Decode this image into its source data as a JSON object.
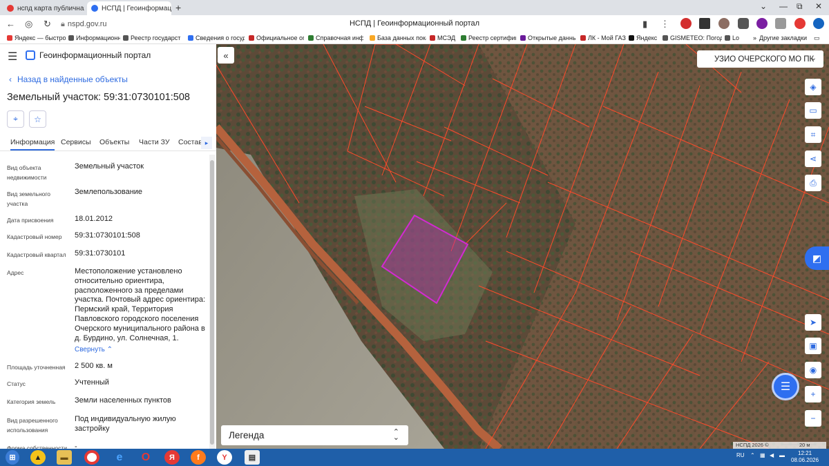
{
  "browser": {
    "tabs": [
      {
        "label": "нспд карта публичная кад",
        "color": "#e53935"
      },
      {
        "label": "НСПД | Геоинформацион",
        "color": "#2f6ff0"
      }
    ],
    "url": "nspd.gov.ru",
    "page_title": "НСПД | Геоинформационный портал",
    "bookmarks": [
      {
        "label": "Яндекс — быстро",
        "color": "#e53935"
      },
      {
        "label": "Информационно",
        "color": "#555"
      },
      {
        "label": "Реестр государст",
        "color": "#555"
      },
      {
        "label": "Сведения о госуд",
        "color": "#2f6ff0"
      },
      {
        "label": "Официальное оп",
        "color": "#c62828"
      },
      {
        "label": "Справочная инф",
        "color": "#2e7d32"
      },
      {
        "label": "База данных пока",
        "color": "#f9a825"
      },
      {
        "label": "МСЭД",
        "color": "#c62828"
      },
      {
        "label": "Реестр сертифик",
        "color": "#2e7d32"
      },
      {
        "label": "Открытые данны",
        "color": "#6a1b9a"
      },
      {
        "label": "ЛК - Мой ГАЗ",
        "color": "#c62828"
      },
      {
        "label": "Яндекс",
        "color": "#111"
      },
      {
        "label": "GISMETEO: Погод",
        "color": "#555"
      },
      {
        "label": "Lo",
        "color": "#555"
      }
    ],
    "other_bookmarks": "Другие закладки"
  },
  "panel": {
    "portal_name": "Геоинформационный портал",
    "back_label": "Назад в найденные объекты",
    "title": "Земельный участок: 59:31:0730101:508",
    "tabs": [
      "Информация",
      "Сервисы",
      "Объекты",
      "Части ЗУ",
      "Состав"
    ],
    "rows": [
      {
        "key": "Вид объекта недвижимости",
        "value": "Земельный участок"
      },
      {
        "key": "Вид земельного участка",
        "value": "Землепользование"
      },
      {
        "key": "Дата присвоения",
        "value": "18.01.2012"
      },
      {
        "key": "Кадастровый номер",
        "value": "59:31:0730101:508"
      },
      {
        "key": "Кадастровый квартал",
        "value": "59:31:0730101"
      },
      {
        "key": "Адрес",
        "value": "Местоположение установлено относительно ориентира, расположенного за пределами участка. Почтовый адрес ориентира: Пермский край, Территория Павловского городского поселения Очерского муниципального района в д. Бурдино, ул. Солнечная, 1."
      },
      {
        "key": "Площадь уточненная",
        "value": "2 500 кв. м"
      },
      {
        "key": "Статус",
        "value": "Учтенный"
      },
      {
        "key": "Категория земель",
        "value": "Земли населенных пунктов"
      },
      {
        "key": "Вид разрешенного использования",
        "value": "Под индивидуальную жилую застройку"
      },
      {
        "key": "Форма собственности",
        "value": "-"
      }
    ],
    "collapse_label": "Свернуть"
  },
  "map": {
    "municipality": "УЗИО ОЧЕРСКОГО МО ПК",
    "legend_label": "Легенда",
    "copyright": "НСПД 2026 ©",
    "scale_label": "20 м",
    "parcel_color": "#c020c0",
    "boundary_color": "#ff4a2a"
  },
  "taskbar": {
    "lang": "RU",
    "time": "12:21",
    "date": "08.06.2026"
  }
}
